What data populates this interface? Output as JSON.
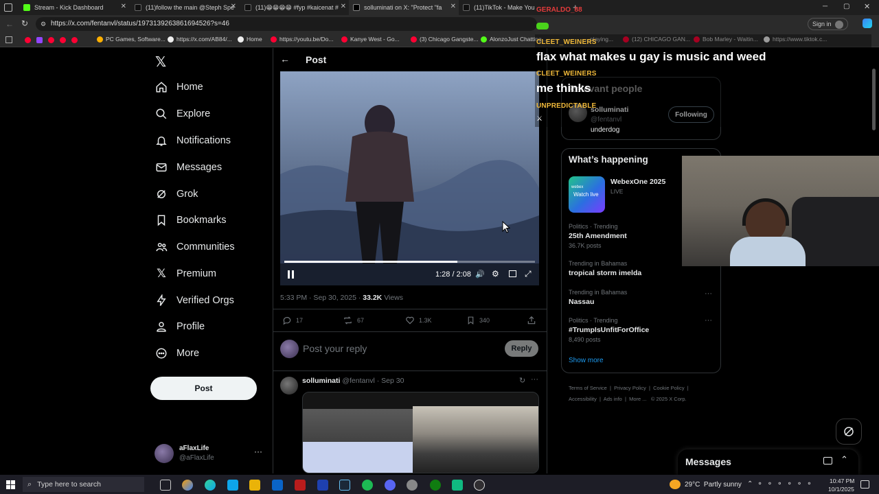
{
  "browser": {
    "tabs": [
      {
        "label": "Stream - Kick Dashboard",
        "color": "#53fc18"
      },
      {
        "label": "(11)follow the main @Steph Spe",
        "color": "#ffffff"
      },
      {
        "label": "(11)😁😁😁😁 #fyp #kaicenat #",
        "color": "#ffffff"
      },
      {
        "label": "solluminati on X: \"Protect \"fa",
        "color": "#ffffff"
      },
      {
        "label": "(11)TikTok - Make Your Day",
        "color": "#ffffff"
      }
    ],
    "url": "https://x.com/fentanvl/status/1973139263861694526?s=46",
    "sign_in": "Sign in",
    "bookmarks": [
      {
        "label": "PC Games, Software...",
        "color": "#ffb000"
      },
      {
        "label": "https://x.com/AB84/...",
        "color": "#ffffff"
      },
      {
        "label": "Home",
        "color": "#ffffff"
      },
      {
        "label": "https://youtu.be/Do...",
        "color": "#ff0033"
      },
      {
        "label": "Kanye West - Go...",
        "color": "#ff0033"
      },
      {
        "label": "(3) Chicago Gangste...",
        "color": "#ff0033"
      },
      {
        "label": "AlonzoJust Chatting...",
        "color": "#53fc18"
      },
      {
        "label": "...playing...",
        "color": "#ff0033"
      },
      {
        "label": "(12) CHICAGO GAN...",
        "color": "#ff0033"
      },
      {
        "label": "Bob Marley - Waitin...",
        "color": "#ff0033"
      },
      {
        "label": "https://www.tiktok.c...",
        "color": "#ffffff"
      }
    ]
  },
  "nav": {
    "items": [
      {
        "label": "Home",
        "icon": "home-icon"
      },
      {
        "label": "Explore",
        "icon": "search-icon"
      },
      {
        "label": "Notifications",
        "icon": "bell-icon"
      },
      {
        "label": "Messages",
        "icon": "mail-icon"
      },
      {
        "label": "Grok",
        "icon": "grok-icon"
      },
      {
        "label": "Bookmarks",
        "icon": "bookmark-icon"
      },
      {
        "label": "Communities",
        "icon": "communities-icon"
      },
      {
        "label": "Premium",
        "icon": "x-icon"
      },
      {
        "label": "Verified Orgs",
        "icon": "bolt-icon"
      },
      {
        "label": "Profile",
        "icon": "person-icon"
      },
      {
        "label": "More",
        "icon": "more-circle-icon"
      }
    ],
    "post_label": "Post",
    "account": {
      "name": "aFlaxLife",
      "handle": "@aFlaxLife"
    }
  },
  "post": {
    "header": "Post",
    "video": {
      "time": "1:28 / 2:08",
      "progress": 0.69
    },
    "meta": {
      "time": "5:33 PM · Sep 30, 2025 · ",
      "views": "33.2K",
      "views_label": " Views"
    },
    "actions": {
      "replies": "17",
      "reposts": "67",
      "likes": "1.3K",
      "bookmarks": "340"
    },
    "reply_placeholder": "Post your reply",
    "reply_button": "Reply",
    "thread": {
      "name": "solluminati",
      "handle": "@fentanvl",
      "date": "· Sep 30"
    }
  },
  "right": {
    "relevant": {
      "title": "Relevant people",
      "name": "solluminati",
      "handle": "@fentanvl",
      "bio": "underdog",
      "button": "Following"
    },
    "happening_title": "What’s happening",
    "event": {
      "title": "WebexOne 2025",
      "status": "LIVE",
      "thumb_label": "Watch live"
    },
    "trends": [
      {
        "meta": "Politics · Trending",
        "title": "25th Amendment",
        "count": "36.7K posts"
      },
      {
        "meta": "Trending in Bahamas",
        "title": "tropical storm imelda",
        "count": ""
      },
      {
        "meta": "Trending in Bahamas",
        "title": "Nassau",
        "count": ""
      },
      {
        "meta": "Politics · Trending",
        "title": "#TrumpIsUnfitForOffice",
        "count": "8,490 posts"
      }
    ],
    "show_more": "Show more",
    "footer": [
      "Terms of Service",
      "Privacy Policy",
      "Cookie Policy",
      "Accessibility",
      "Ads info",
      "More ...",
      "© 2025 X Corp."
    ],
    "messages_label": "Messages"
  },
  "overlay": {
    "chat": [
      {
        "user": "CLEET_WEINERS",
        "msg": "flax what makes u gay is music and weed"
      },
      {
        "user": "CLEET_WEINERS",
        "msg": "me thinks"
      },
      {
        "user": "UNPREDICTABLE",
        "msg": ""
      }
    ],
    "top_user": "GERALDO_88"
  },
  "taskbar": {
    "search_placeholder": "Type here to search",
    "weather": "29°C  Partly sunny",
    "time": "10:47 PM",
    "date": "10/1/2025"
  }
}
